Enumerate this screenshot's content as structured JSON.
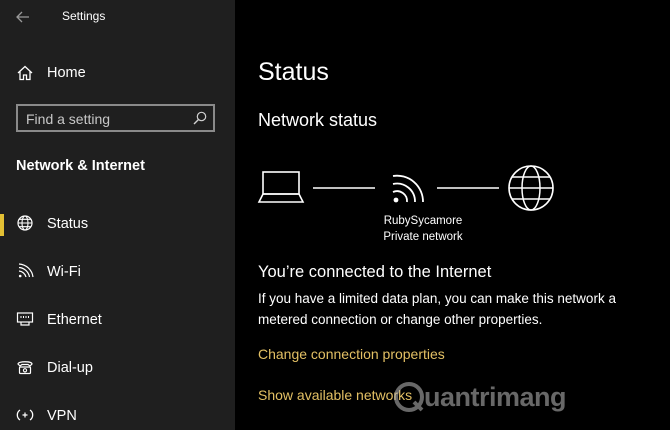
{
  "window": {
    "title": "Settings"
  },
  "sidebar": {
    "home_label": "Home",
    "search": {
      "placeholder": "Find a setting",
      "value": ""
    },
    "section_title": "Network & Internet",
    "items": [
      {
        "label": "Status",
        "icon": "globe-icon",
        "active": true
      },
      {
        "label": "Wi-Fi",
        "icon": "wifi-icon",
        "active": false
      },
      {
        "label": "Ethernet",
        "icon": "ethernet-icon",
        "active": false
      },
      {
        "label": "Dial-up",
        "icon": "dial-up-icon",
        "active": false
      },
      {
        "label": "VPN",
        "icon": "vpn-icon",
        "active": false
      }
    ]
  },
  "main": {
    "title": "Status",
    "network_status_heading": "Network status",
    "network": {
      "name": "RubySycamore",
      "type": "Private network"
    },
    "connected_heading": "You’re connected to the Internet",
    "description": "If you have a limited data plan, you can make this network a metered connection or change other properties.",
    "links": {
      "change_properties": "Change connection properties",
      "show_networks": "Show available networks"
    }
  },
  "watermark": {
    "text": "uantrimang"
  },
  "colors": {
    "sidebar_bg": "#1f1f1f",
    "main_bg": "#000000",
    "accent": "#e3c034",
    "link": "#e3c064",
    "text": "#ffffff"
  }
}
